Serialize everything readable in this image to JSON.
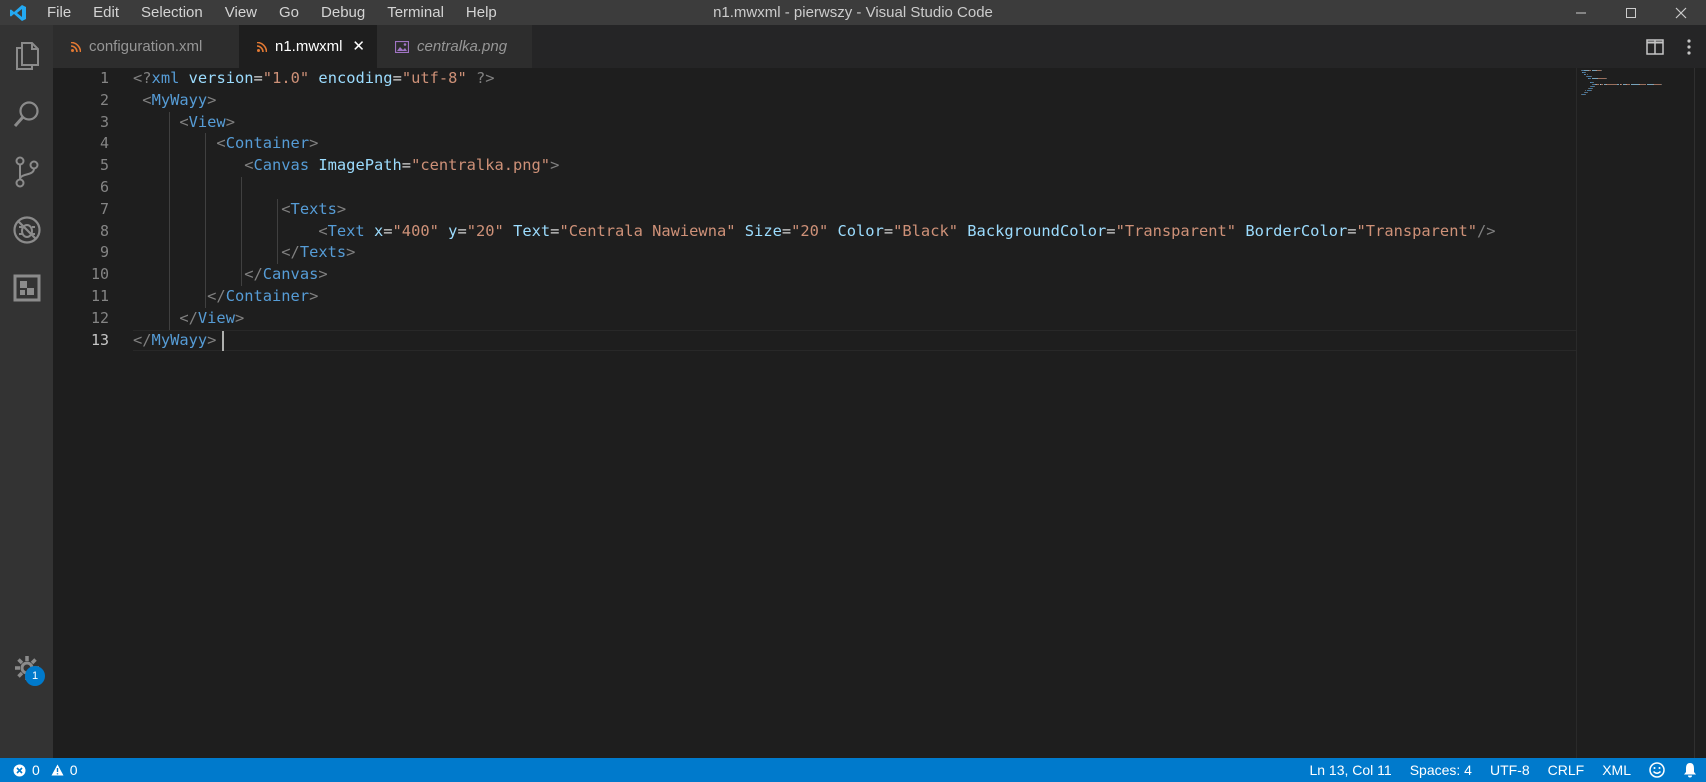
{
  "window": {
    "title": "n1.mwxml - pierwszy - Visual Studio Code",
    "menu": [
      "File",
      "Edit",
      "Selection",
      "View",
      "Go",
      "Debug",
      "Terminal",
      "Help"
    ],
    "controls": [
      "minimize-icon",
      "maximize-icon",
      "close-icon"
    ]
  },
  "activity_bar": {
    "items": [
      "explorer-icon",
      "search-icon",
      "source-control-icon",
      "debug-icon",
      "extensions-icon"
    ],
    "settings_badge": "1"
  },
  "tabs": [
    {
      "label": "configuration.xml",
      "icon": "rss-file-icon",
      "active": false,
      "italic": false
    },
    {
      "label": "n1.mwxml",
      "icon": "rss-file-icon",
      "active": true,
      "italic": false,
      "close": "✕"
    },
    {
      "label": "centralka.png",
      "icon": "image-file-icon",
      "active": false,
      "italic": true
    }
  ],
  "editor": {
    "line_numbers": [
      "1",
      "2",
      "3",
      "4",
      "5",
      "6",
      "7",
      "8",
      "9",
      "10",
      "11",
      "12",
      "13"
    ],
    "current_line": "13",
    "lines": [
      [
        {
          "t": "<?",
          "c": "bracket"
        },
        {
          "t": "xml",
          "c": "tag"
        },
        {
          "t": " "
        },
        {
          "t": "version",
          "c": "attr"
        },
        {
          "t": "=",
          "c": "eq"
        },
        {
          "t": "\"1.0\"",
          "c": "str"
        },
        {
          "t": " "
        },
        {
          "t": "encoding",
          "c": "attr"
        },
        {
          "t": "=",
          "c": "eq"
        },
        {
          "t": "\"utf-8\"",
          "c": "str"
        },
        {
          "t": " "
        },
        {
          "t": "?>",
          "c": "bracket"
        }
      ],
      [
        {
          "t": " "
        },
        {
          "t": "<",
          "c": "bracket"
        },
        {
          "t": "MyWayy",
          "c": "tag"
        },
        {
          "t": ">",
          "c": "bracket"
        }
      ],
      [
        {
          "t": "     "
        },
        {
          "t": "<",
          "c": "bracket"
        },
        {
          "t": "View",
          "c": "tag"
        },
        {
          "t": ">",
          "c": "bracket"
        }
      ],
      [
        {
          "t": "         "
        },
        {
          "t": "<",
          "c": "bracket"
        },
        {
          "t": "Container",
          "c": "tag"
        },
        {
          "t": ">",
          "c": "bracket"
        }
      ],
      [
        {
          "t": "            "
        },
        {
          "t": "<",
          "c": "bracket"
        },
        {
          "t": "Canvas",
          "c": "tag"
        },
        {
          "t": " "
        },
        {
          "t": "ImagePath",
          "c": "attr"
        },
        {
          "t": "=",
          "c": "eq"
        },
        {
          "t": "\"centralka.png\"",
          "c": "str"
        },
        {
          "t": ">",
          "c": "bracket"
        }
      ],
      [
        {
          "t": ""
        }
      ],
      [
        {
          "t": "                "
        },
        {
          "t": "<",
          "c": "bracket"
        },
        {
          "t": "Texts",
          "c": "tag"
        },
        {
          "t": ">",
          "c": "bracket"
        }
      ],
      [
        {
          "t": "                    "
        },
        {
          "t": "<",
          "c": "bracket"
        },
        {
          "t": "Text",
          "c": "tag"
        },
        {
          "t": " "
        },
        {
          "t": "x",
          "c": "attr"
        },
        {
          "t": "=",
          "c": "eq"
        },
        {
          "t": "\"400\"",
          "c": "str"
        },
        {
          "t": " "
        },
        {
          "t": "y",
          "c": "attr"
        },
        {
          "t": "=",
          "c": "eq"
        },
        {
          "t": "\"20\"",
          "c": "str"
        },
        {
          "t": " "
        },
        {
          "t": "Text",
          "c": "attr"
        },
        {
          "t": "=",
          "c": "eq"
        },
        {
          "t": "\"Centrala Nawiewna\"",
          "c": "str"
        },
        {
          "t": " "
        },
        {
          "t": "Size",
          "c": "attr"
        },
        {
          "t": "=",
          "c": "eq"
        },
        {
          "t": "\"20\"",
          "c": "str"
        },
        {
          "t": " "
        },
        {
          "t": "Color",
          "c": "attr"
        },
        {
          "t": "=",
          "c": "eq"
        },
        {
          "t": "\"Black\"",
          "c": "str"
        },
        {
          "t": " "
        },
        {
          "t": "BackgroundColor",
          "c": "attr"
        },
        {
          "t": "=",
          "c": "eq"
        },
        {
          "t": "\"Transparent\"",
          "c": "str"
        },
        {
          "t": " "
        },
        {
          "t": "BorderColor",
          "c": "attr"
        },
        {
          "t": "=",
          "c": "eq"
        },
        {
          "t": "\"Transparent\"",
          "c": "str"
        },
        {
          "t": "/>",
          "c": "bracket"
        }
      ],
      [
        {
          "t": "                "
        },
        {
          "t": "</",
          "c": "bracket"
        },
        {
          "t": "Texts",
          "c": "tag"
        },
        {
          "t": ">",
          "c": "bracket"
        }
      ],
      [
        {
          "t": "            "
        },
        {
          "t": "</",
          "c": "bracket"
        },
        {
          "t": "Canvas",
          "c": "tag"
        },
        {
          "t": ">",
          "c": "bracket"
        }
      ],
      [
        {
          "t": "        "
        },
        {
          "t": "</",
          "c": "bracket"
        },
        {
          "t": "Container",
          "c": "tag"
        },
        {
          "t": ">",
          "c": "bracket"
        }
      ],
      [
        {
          "t": "     "
        },
        {
          "t": "</",
          "c": "bracket"
        },
        {
          "t": "View",
          "c": "tag"
        },
        {
          "t": ">",
          "c": "bracket"
        }
      ],
      [
        {
          "t": "</",
          "c": "bracket"
        },
        {
          "t": "MyWayy",
          "c": "tag"
        },
        {
          "t": ">",
          "c": "bracket"
        },
        {
          "t": " "
        }
      ]
    ]
  },
  "status_bar": {
    "errors": "0",
    "warnings": "0",
    "position": "Ln 13, Col 11",
    "spaces": "Spaces: 4",
    "encoding": "UTF-8",
    "eol": "CRLF",
    "language": "XML"
  },
  "colors": {
    "accent": "#007acc",
    "tag": "#569cd6",
    "attribute": "#9cdcfe",
    "string": "#ce9178",
    "punctuation": "#808080",
    "rss_icon": "#e37933",
    "image_icon": "#a074c4"
  }
}
